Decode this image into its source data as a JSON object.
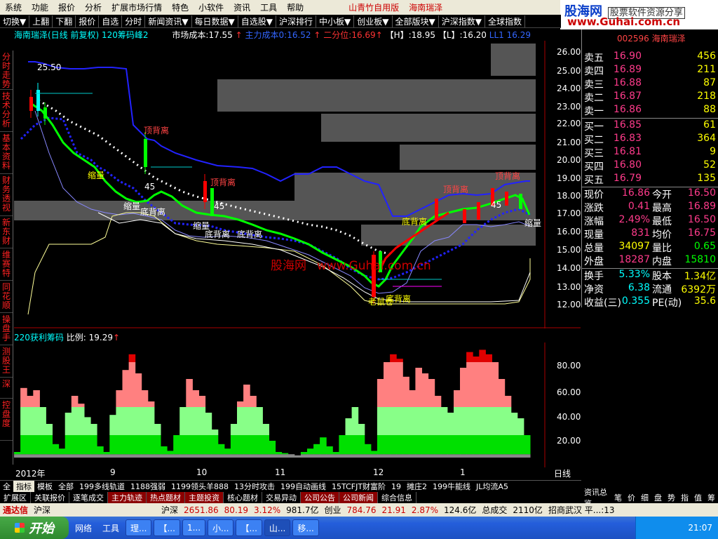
{
  "menu": {
    "items": [
      "系统",
      "功能",
      "报价",
      "分析",
      "扩展市场行情",
      "特色",
      "小软件",
      "资讯",
      "工具",
      "帮助"
    ],
    "app_title": "山青竹自用版",
    "stock_title": "海南瑞泽"
  },
  "logo": {
    "main": "股海网",
    "sub": "股票软件资源分享",
    "url": "www.Guhai.com.cn"
  },
  "toolbar": {
    "items": [
      "切换▼",
      "上翻",
      "下翻",
      "报价",
      "自选",
      "分时",
      "新闻资讯▼",
      "每日数据▼",
      "自选股▼",
      "沪深排行",
      "中小板▼",
      "创业板▼",
      "全部版块▼",
      "沪深指数▼",
      "全球指数"
    ]
  },
  "leftnav": {
    "items": [
      "分时走势",
      "技术分析",
      "基本资料",
      "财务透视",
      "新东财",
      "维赛特",
      "同花顺",
      "操盘手",
      "测股王",
      "深",
      "控盘度"
    ]
  },
  "chart_header": {
    "name": "海南瑞泽(日线 前复权)",
    "indicator": "120筹码峰2",
    "cost_label": "市场成本:",
    "cost_value": "17.55",
    "main_cost_label": "主力成本0:",
    "main_cost_value": "16.52",
    "median_label": "二分位:",
    "median_value": "16.69",
    "h_label": "【H】:",
    "h_value": "18.95",
    "l_label": "【L】:",
    "l_value": "16.20",
    "ll_label": "LL1",
    "ll_value": "16.29"
  },
  "price_axis": {
    "ticks": [
      "26.00",
      "25.00",
      "24.00",
      "23.00",
      "22.00",
      "21.00",
      "20.00",
      "19.00",
      "18.00",
      "17.00",
      "16.00",
      "15.00",
      "14.00",
      "13.00",
      "12.00"
    ]
  },
  "chart_annotations": {
    "top_price": "25.50",
    "low_price": "12.60",
    "labels": [
      "顶背离",
      "顶背离",
      "顶背离",
      "顶背离",
      "底背离",
      "底背离",
      "底背离",
      "底背离",
      "底背离",
      "缩量",
      "缩量",
      "缩量",
      "缩量",
      "45",
      "45",
      "45",
      "老鼠仓"
    ],
    "watermark_cn": "股海网",
    "watermark_url": "www.Guhai.com.cn"
  },
  "indicator_panel": {
    "name": "220获利筹码",
    "ratio_label": "比例:",
    "ratio_value": "19.29",
    "ticks": [
      "80.00",
      "60.00",
      "40.00",
      "20.00"
    ]
  },
  "chart_data": {
    "type": "bar",
    "title": "220获利筹码",
    "xlabel": "",
    "ylabel": "",
    "ylim": [
      0,
      100
    ],
    "categories": [
      "2012年",
      "9",
      "10",
      "11",
      "12",
      "1"
    ],
    "series": [
      {
        "values": [
          5,
          62,
          55,
          60,
          45,
          30,
          12,
          8,
          40,
          55,
          48,
          36,
          30,
          10,
          5,
          38,
          60,
          78,
          92,
          75,
          60,
          50,
          30,
          10,
          6,
          20,
          45,
          70,
          60,
          55,
          40,
          25,
          12,
          8,
          30,
          50,
          65,
          55,
          45,
          30,
          15,
          5,
          4,
          3,
          2,
          5,
          8,
          12,
          18,
          10,
          5,
          20,
          35,
          45,
          30,
          12,
          6,
          70,
          85,
          92,
          88,
          72,
          60,
          80,
          75,
          70,
          55,
          45,
          40,
          60,
          80,
          94,
          90,
          96,
          92,
          85,
          70,
          55,
          40,
          35,
          20
        ]
      }
    ],
    "grid": false
  },
  "quote": {
    "code_header": "002596 海南瑞泽",
    "asks": [
      {
        "label": "卖五",
        "price": "16.90",
        "vol": "456"
      },
      {
        "label": "卖四",
        "price": "16.89",
        "vol": "211"
      },
      {
        "label": "卖三",
        "price": "16.88",
        "vol": "87"
      },
      {
        "label": "卖二",
        "price": "16.87",
        "vol": "218"
      },
      {
        "label": "卖一",
        "price": "16.86",
        "vol": "88"
      }
    ],
    "bids": [
      {
        "label": "买一",
        "price": "16.85",
        "vol": "61"
      },
      {
        "label": "买二",
        "price": "16.83",
        "vol": "364"
      },
      {
        "label": "买三",
        "price": "16.81",
        "vol": "9"
      },
      {
        "label": "买四",
        "price": "16.80",
        "vol": "52"
      },
      {
        "label": "买五",
        "price": "16.79",
        "vol": "135"
      }
    ],
    "stats": [
      {
        "l1": "现价",
        "v1": "16.86",
        "l2": "今开",
        "v2": "16.50"
      },
      {
        "l1": "涨跌",
        "v1": "0.41",
        "l2": "最高",
        "v2": "16.89"
      },
      {
        "l1": "涨幅",
        "v1": "2.49%",
        "l2": "最低",
        "v2": "16.50"
      },
      {
        "l1": "现量",
        "v1": "831",
        "l2": "均价",
        "v2": "16.75"
      },
      {
        "l1": "总量",
        "v1": "34097",
        "l2": "量比",
        "v2": "0.65"
      },
      {
        "l1": "外盘",
        "v1": "18287",
        "l2": "内盘",
        "v2": "15810"
      }
    ],
    "stats2": [
      {
        "l1": "换手",
        "v1": "5.33%",
        "l2": "股本",
        "v2": "1.34亿"
      },
      {
        "l1": "净资",
        "v1": "6.38",
        "l2": "流通",
        "v2": "6392万"
      },
      {
        "l1": "收益(三)",
        "v1": "0.355",
        "l2": "PE(动)",
        "v2": "35.6"
      }
    ]
  },
  "period": "日线",
  "dates": [
    "2012年",
    "9",
    "10",
    "11",
    "12",
    "1"
  ],
  "indicator_tabs": [
    "全",
    "指标",
    "模板",
    "全部",
    "199多线轨道",
    "1188强弱",
    "1199领头羊888",
    "13分时攻击",
    "199自动画线",
    "15TCFJT财富阶",
    "19",
    "摊庄2",
    "199牛能线",
    "JL均流A5"
  ],
  "bottom_tabs": [
    "扩展区",
    "关联报价",
    "逐笔成交",
    "主力轨迹",
    "热点题材",
    "主题投资",
    "核心题材",
    "交易异动",
    "公司公告",
    "公司新闻",
    "综合信息"
  ],
  "right_tabs": [
    "资讯总览",
    "笔",
    "价",
    "细",
    "盘",
    "势",
    "指",
    "值",
    "筹"
  ],
  "status": {
    "brand": "通达信",
    "market": "沪深",
    "sh_label": "沪深",
    "sh_index": "2651.86",
    "sh_change": "80.19",
    "sh_pct": "3.12%",
    "sh_amount": "981.7亿",
    "cy_label": "创业",
    "cy_index": "784.76",
    "cy_change": "21.91",
    "cy_pct": "2.87%",
    "cy_amount": "124.6亿",
    "trade_label": "总成交",
    "trade_value": "2110亿",
    "broker": "招商武汉 平...:13"
  },
  "taskbar": {
    "start": "开始",
    "tasks": [
      "网络",
      "工具",
      "理...",
      "【...",
      "1...",
      "小...",
      "【...",
      "山...",
      "移..."
    ],
    "time": "21:07"
  }
}
